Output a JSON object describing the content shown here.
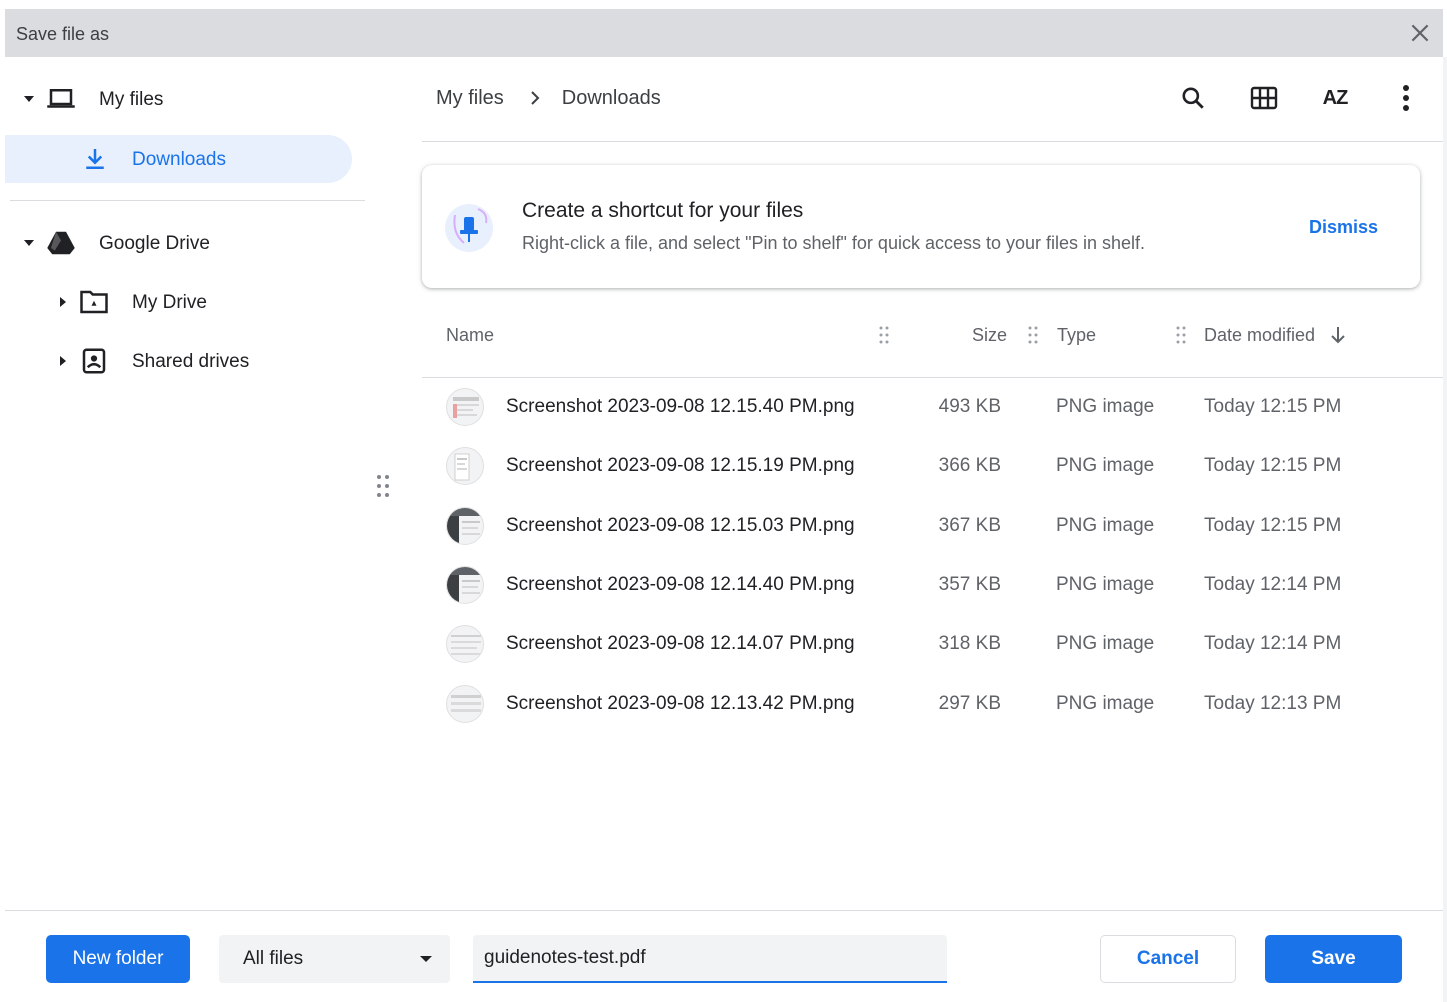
{
  "dialog": {
    "title": "Save file as"
  },
  "sidebar": {
    "my_files": "My files",
    "downloads": "Downloads",
    "google_drive": "Google Drive",
    "my_drive": "My Drive",
    "shared_drives": "Shared drives"
  },
  "breadcrumb": {
    "root": "My files",
    "current": "Downloads"
  },
  "toolbar": {
    "sort_label": "AZ"
  },
  "banner": {
    "title": "Create a shortcut for your files",
    "text": "Right-click a file, and select \"Pin to shelf\" for quick access to your files in shelf.",
    "dismiss": "Dismiss"
  },
  "columns": {
    "name": "Name",
    "size": "Size",
    "type": "Type",
    "date": "Date modified"
  },
  "files": [
    {
      "name": "Screenshot 2023-09-08 12.15.40 PM.png",
      "size": "493 KB",
      "type": "PNG image",
      "date": "Today 12:15 PM"
    },
    {
      "name": "Screenshot 2023-09-08 12.15.19 PM.png",
      "size": "366 KB",
      "type": "PNG image",
      "date": "Today 12:15 PM"
    },
    {
      "name": "Screenshot 2023-09-08 12.15.03 PM.png",
      "size": "367 KB",
      "type": "PNG image",
      "date": "Today 12:15 PM"
    },
    {
      "name": "Screenshot 2023-09-08 12.14.40 PM.png",
      "size": "357 KB",
      "type": "PNG image",
      "date": "Today 12:14 PM"
    },
    {
      "name": "Screenshot 2023-09-08 12.14.07 PM.png",
      "size": "318 KB",
      "type": "PNG image",
      "date": "Today 12:14 PM"
    },
    {
      "name": "Screenshot 2023-09-08 12.13.42 PM.png",
      "size": "297 KB",
      "type": "PNG image",
      "date": "Today 12:13 PM"
    }
  ],
  "footer": {
    "new_folder": "New folder",
    "filter": "All files",
    "filename": "guidenotes-test.pdf",
    "cancel": "Cancel",
    "save": "Save"
  },
  "colors": {
    "accent": "#1a73e8",
    "selected_bg": "#e8f0fe",
    "titlebar": "#dadce0"
  }
}
